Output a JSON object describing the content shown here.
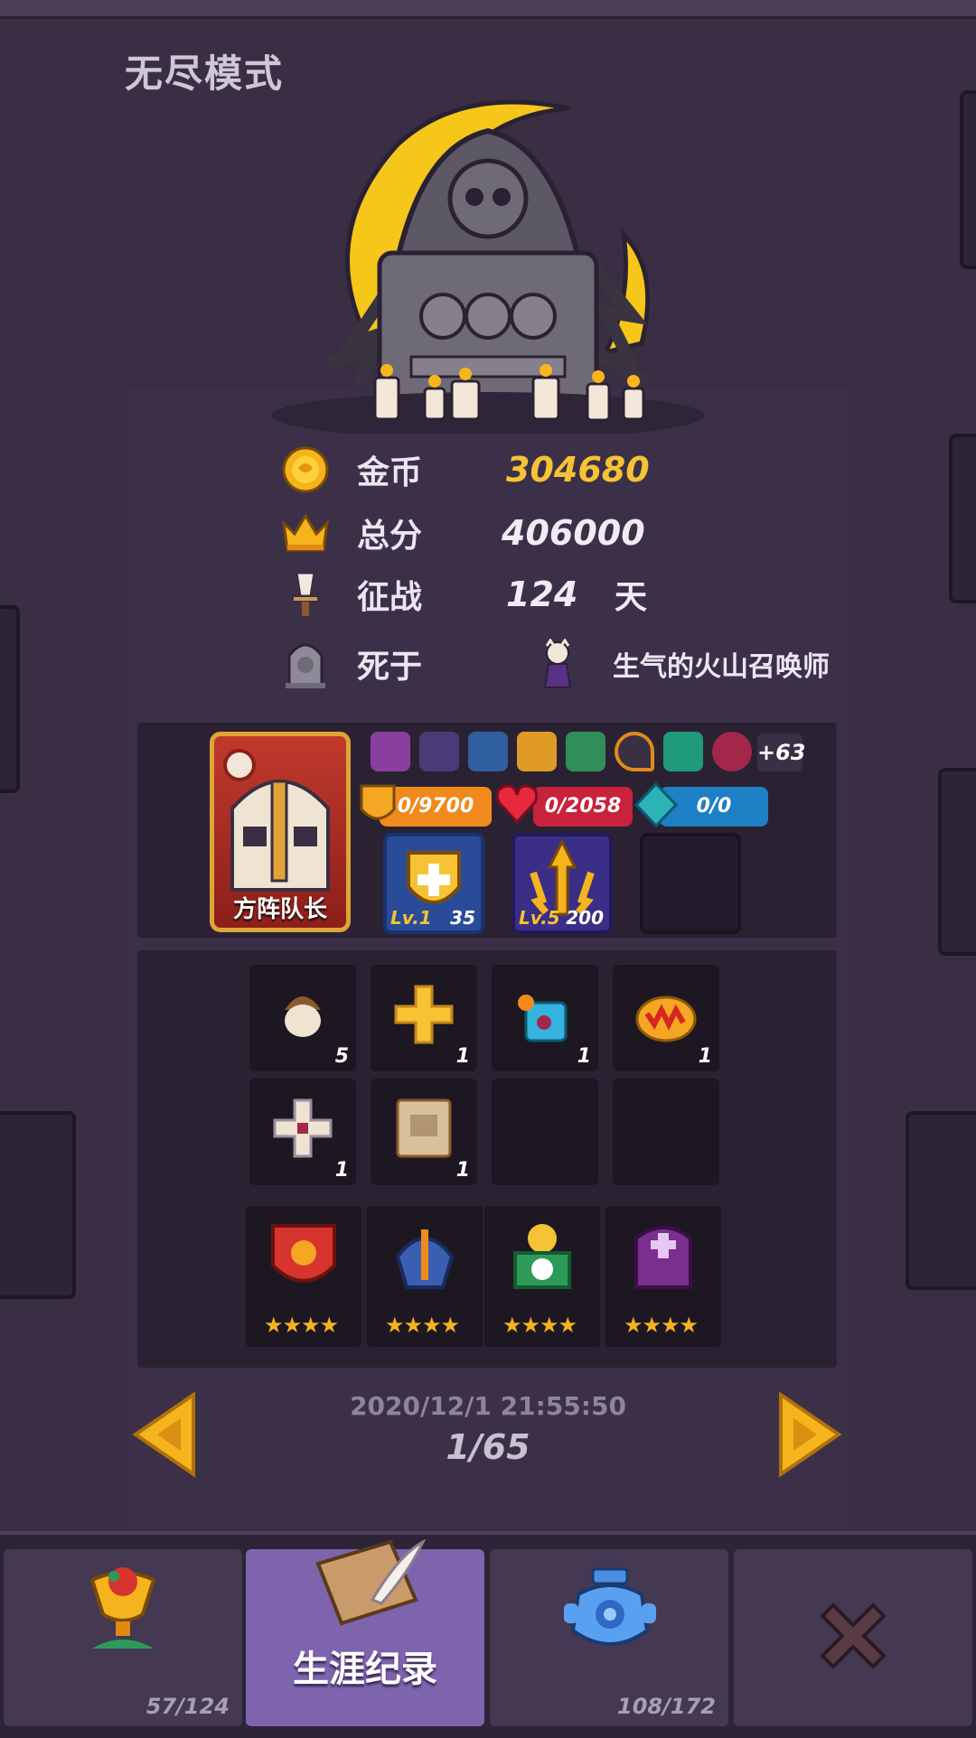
{
  "header": {
    "title": "无尽模式"
  },
  "stats": {
    "gold": {
      "label": "金币",
      "value": "304680",
      "value_color": "#f5c334",
      "icon": "gold-coin-icon"
    },
    "score": {
      "label": "总分",
      "value": "406000",
      "icon": "crown-icon"
    },
    "campaign": {
      "label": "征战",
      "value": "124",
      "unit": "天",
      "icon": "sword-icon"
    },
    "death": {
      "label": "死于",
      "killer": "生气的火山召唤师",
      "icon": "tombstone-icon"
    }
  },
  "hero": {
    "name": "方阵队长",
    "extra_relics": "+63",
    "armor": "0/9700",
    "health": "0/2058",
    "mana": "0/0",
    "skills": [
      {
        "level": "Lv.1",
        "value": "35",
        "icon": "shield-plus-icon"
      },
      {
        "level": "Lv.5",
        "value": "200",
        "icon": "triple-arrow-icon"
      }
    ]
  },
  "items": [
    {
      "count": "5",
      "icon": "acorn-icon"
    },
    {
      "count": "1",
      "icon": "gold-cross-icon"
    },
    {
      "count": "1",
      "icon": "cocktail-icon"
    },
    {
      "count": "1",
      "icon": "pie-icon"
    },
    {
      "count": "1",
      "icon": "bandage-cross-icon"
    },
    {
      "count": "1",
      "icon": "wanted-poster-icon"
    }
  ],
  "allies": [
    {
      "stars": "★★★★",
      "icon": "red-shield-tower-icon"
    },
    {
      "stars": "★★★★",
      "icon": "crossbow-tower-icon"
    },
    {
      "stars": "★★★★",
      "icon": "clock-tower-icon"
    },
    {
      "stars": "★★★★",
      "icon": "priest-icon"
    }
  ],
  "record": {
    "date": "2020/12/1 21:55:50",
    "page": "1/65"
  },
  "tabs": [
    {
      "count": "57/124",
      "icon": "trophy-cup-icon"
    },
    {
      "label": "生涯纪录",
      "icon": "scroll-quill-icon"
    },
    {
      "count": "108/172",
      "icon": "blue-vase-icon"
    },
    {
      "icon": "close-icon"
    }
  ],
  "colors": {
    "accent_gold": "#f5c334",
    "armor_bar": "#f08a1c",
    "health_bar": "#c8223c",
    "mana_bar": "#1d7fc4",
    "active_tab": "#7e63ad"
  }
}
